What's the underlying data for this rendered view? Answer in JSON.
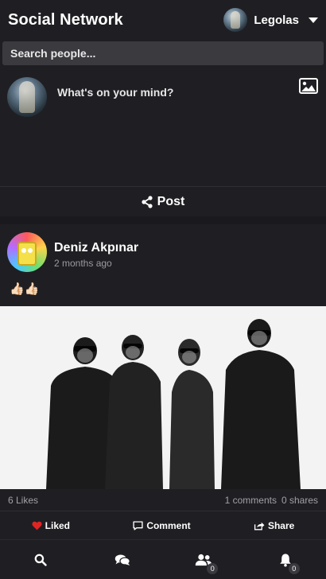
{
  "app": {
    "title": "Social Network"
  },
  "user": {
    "name": "Legolas"
  },
  "search": {
    "placeholder": "Search people..."
  },
  "composer": {
    "prompt": "What's on your mind?",
    "post_label": "Post"
  },
  "post": {
    "author": "Deniz Akpınar",
    "time": "2 months ago",
    "text": "👍🏻👍🏻",
    "likes": "6 Likes",
    "comments": "1 comments",
    "shares": "0 shares",
    "actions": {
      "like": "Liked",
      "comment": "Comment",
      "share": "Share"
    }
  },
  "nav": {
    "friends_badge": "0",
    "notifications_badge": "0"
  },
  "colors": {
    "liked_heart": "#e02424",
    "background": "#1a1a1e",
    "panel": "#1f1f23"
  },
  "icons": [
    "image-icon",
    "share-icon",
    "heart-icon",
    "comment-icon",
    "search-icon",
    "chat-icon",
    "friends-icon",
    "bell-icon",
    "caret-down-icon"
  ]
}
